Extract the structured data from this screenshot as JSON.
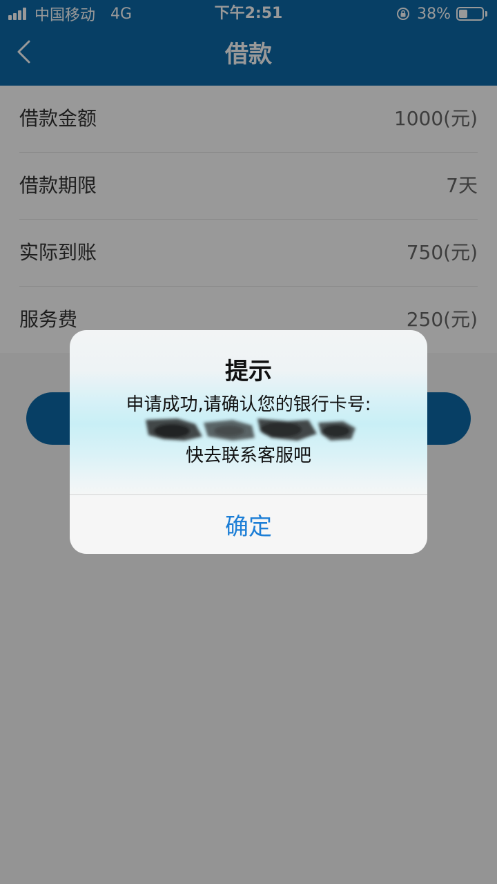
{
  "status_bar": {
    "carrier": "中国移动",
    "network": "4G",
    "time": "下午2:51",
    "battery_percent": "38%",
    "battery_level": 0.38
  },
  "nav": {
    "title": "借款"
  },
  "loan_details": [
    {
      "label": "借款金额",
      "value": "1000(元)"
    },
    {
      "label": "借款期限",
      "value": "7天"
    },
    {
      "label": "实际到账",
      "value": "750(元)"
    },
    {
      "label": "服务费",
      "value": "250(元)"
    }
  ],
  "dialog": {
    "title": "提示",
    "message_line1": "申请成功,请确认您的银行卡号:",
    "message_line3": "快去联系客服吧",
    "confirm_label": "确定"
  },
  "colors": {
    "brand_blue": "#0d6aa8",
    "link_blue": "#1c7ed6"
  }
}
